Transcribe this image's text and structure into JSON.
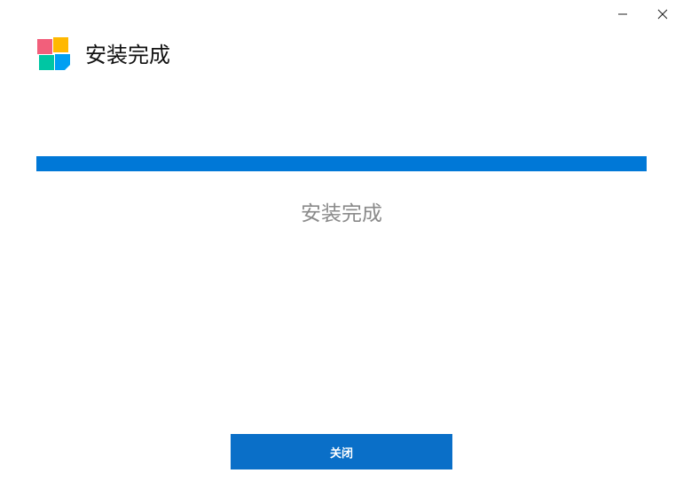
{
  "window": {
    "title": "安装完成",
    "caption_buttons": [
      {
        "name": "minimize-icon"
      },
      {
        "name": "close-icon"
      }
    ]
  },
  "logo": {
    "icon": "windows-style-tiles-icon",
    "colors": [
      "#f25f7b",
      "#ffb800",
      "#00c6a3",
      "#009ff2"
    ]
  },
  "progress": {
    "percent": 100,
    "color": "#0078d7"
  },
  "status": {
    "text": "安装完成"
  },
  "footer": {
    "close_label": "关闭",
    "button_color": "#0a6fc8"
  }
}
